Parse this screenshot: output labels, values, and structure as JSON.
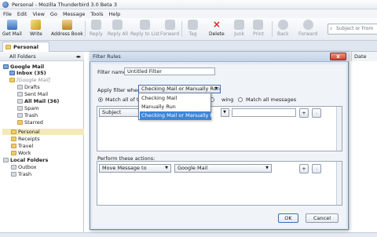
{
  "window": {
    "title": "Personal - Mozilla Thunderbird 3.0 Beta 3"
  },
  "menu": [
    "File",
    "Edit",
    "View",
    "Go",
    "Message",
    "Tools",
    "Help"
  ],
  "toolbar": {
    "get_mail": "Get Mail",
    "write": "Write",
    "address_book": "Address Book",
    "reply": "Reply",
    "reply_all": "Reply All",
    "reply_list": "Reply to List",
    "forward": "Forward",
    "tag": "Tag",
    "delete": "Delete",
    "junk": "Junk",
    "print": "Print",
    "back": "Back",
    "forward_nav": "Forward",
    "search_placeholder": "Subject or From"
  },
  "tab": {
    "label": "Personal"
  },
  "folders": {
    "header": "All Folders",
    "items": [
      {
        "label": "Google Mail"
      },
      {
        "label": "Inbox (35)"
      },
      {
        "label": "[Google Mail]"
      },
      {
        "label": "Drafts"
      },
      {
        "label": "Sent Mail"
      },
      {
        "label": "All Mail (36)"
      },
      {
        "label": "Spam"
      },
      {
        "label": "Trash"
      },
      {
        "label": "Starred"
      },
      {
        "label": "Personal"
      },
      {
        "label": "Receipts"
      },
      {
        "label": "Travel"
      },
      {
        "label": "Work"
      },
      {
        "label": "Local Folders"
      },
      {
        "label": "Outbox"
      },
      {
        "label": "Trash"
      }
    ]
  },
  "list": {
    "date_header": "Date"
  },
  "dialog": {
    "title": "Filter Rules",
    "filter_name_label": "Filter name:",
    "filter_name_value": "Untitled Filter",
    "apply_label": "Apply filter when:",
    "apply_value": "Checking Mail or Manually Run",
    "apply_options": [
      "Checking Mail",
      "Manually Run",
      "Checking Mail or Manually Run"
    ],
    "match_all_label": "Match all of the",
    "match_any_tail": "wing",
    "match_all_messages": "Match all messages",
    "criteria_field": "Subject",
    "add": "+",
    "remove": "-",
    "actions_label": "Perform these actions:",
    "action_value": "Move Message to",
    "action_target": "Google Mail",
    "ok": "OK",
    "cancel": "Cancel"
  },
  "colors": {
    "accent": "#3d86d9",
    "selected_folder": "#f3e9b9"
  }
}
